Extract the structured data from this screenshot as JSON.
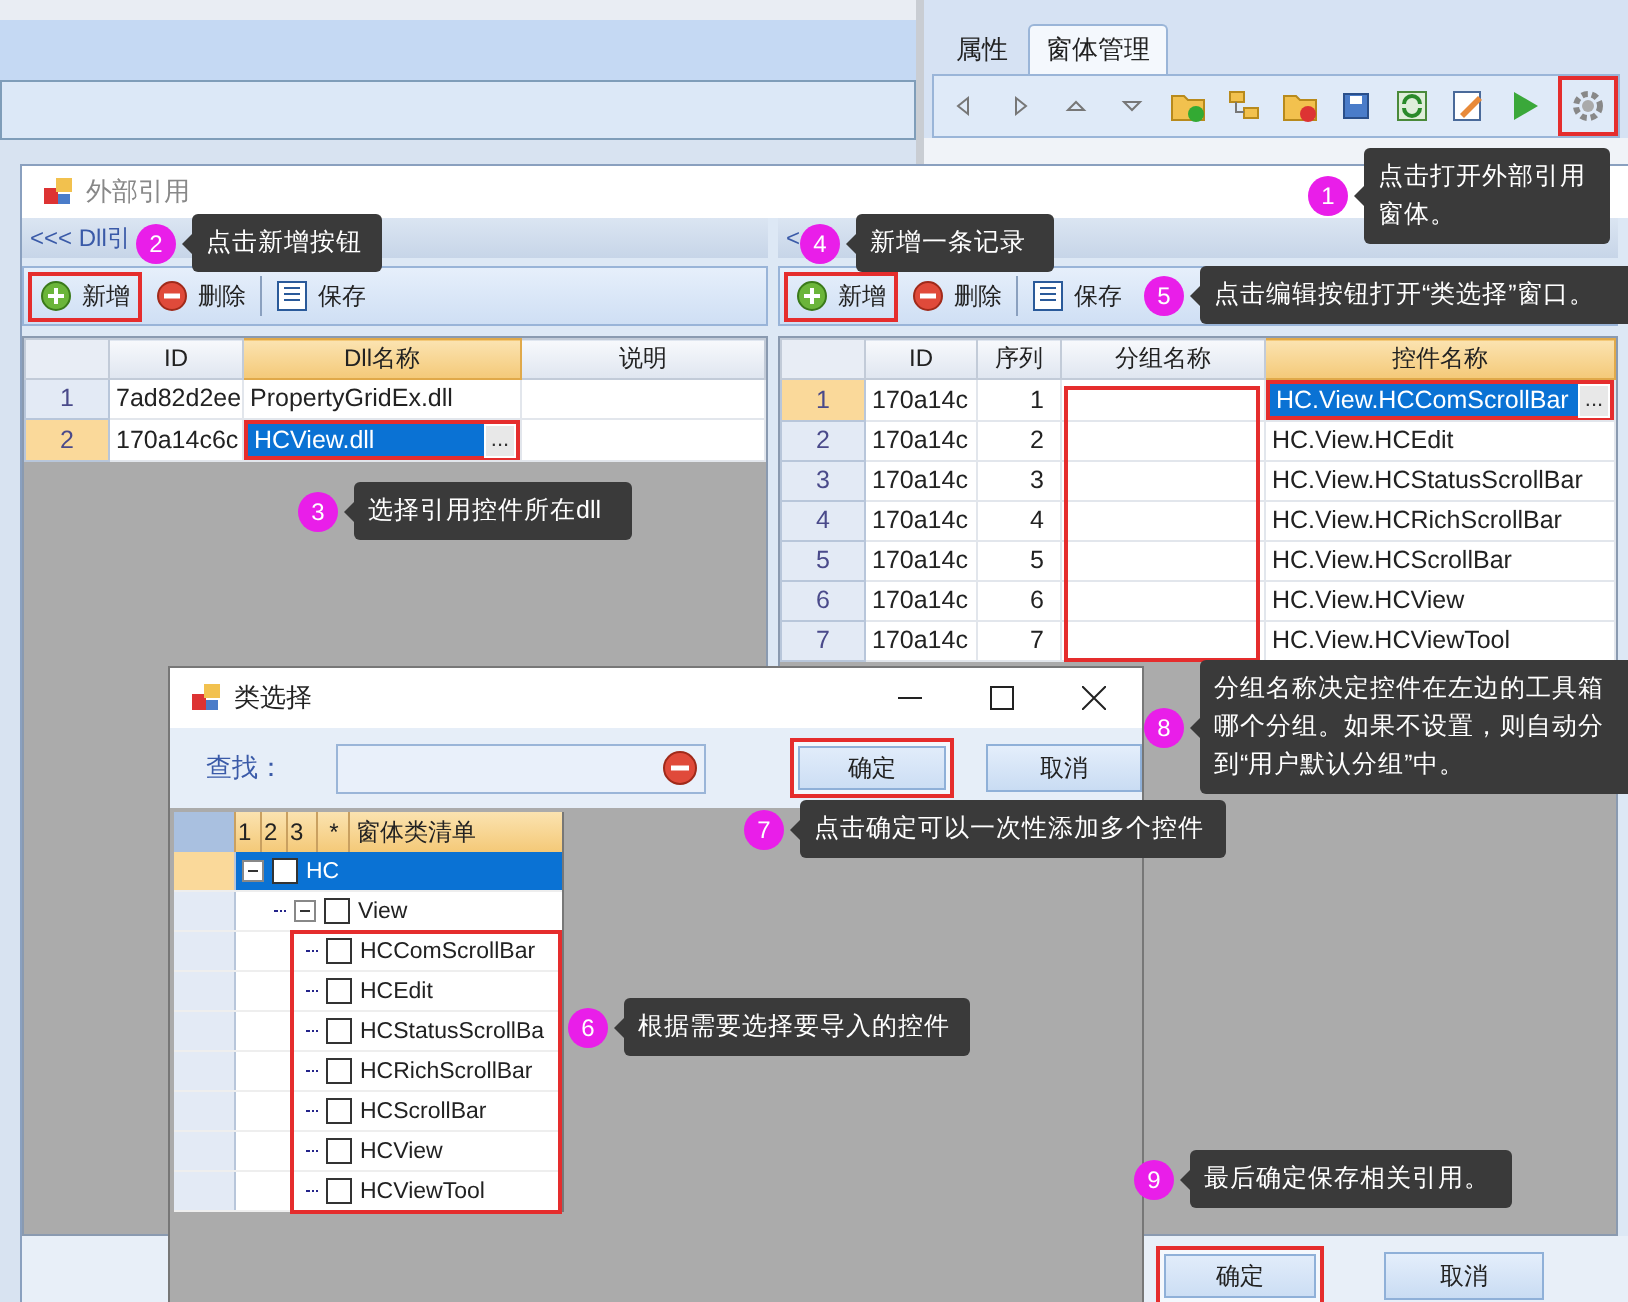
{
  "ide": {
    "tabs": [
      {
        "label": "属性",
        "selected": false
      },
      {
        "label": "窗体管理",
        "selected": true
      }
    ],
    "toolbar": [
      {
        "kind": "left",
        "highlighted": false
      },
      {
        "kind": "right",
        "highlighted": false
      },
      {
        "kind": "up",
        "highlighted": false
      },
      {
        "kind": "down",
        "highlighted": false
      },
      {
        "kind": "folder-add",
        "highlighted": false
      },
      {
        "kind": "tree",
        "highlighted": false
      },
      {
        "kind": "folder-remove",
        "highlighted": false
      },
      {
        "kind": "save",
        "highlighted": false
      },
      {
        "kind": "refresh",
        "highlighted": false
      },
      {
        "kind": "edit",
        "highlighted": false
      },
      {
        "kind": "run",
        "highlighted": false
      },
      {
        "kind": "settings",
        "highlighted": true
      }
    ]
  },
  "reference_dialog": {
    "title": "外部引用",
    "dll_pane": {
      "header": "<<< Dll引",
      "toolbar": [
        {
          "kind": "add",
          "label": "新增",
          "highlighted": true
        },
        {
          "kind": "delete",
          "label": "删除",
          "highlighted": false
        },
        {
          "kind": "save",
          "label": "保存",
          "highlighted": false
        }
      ],
      "columns": [
        {
          "label": "ID",
          "selected": false
        },
        {
          "label": "Dll名称",
          "selected": true
        },
        {
          "label": "说明",
          "selected": false
        }
      ],
      "rows": [
        {
          "number": "1",
          "selected": false,
          "id": "7ad82d2ee",
          "name": "PropertyGridEx.dll"
        },
        {
          "number": "2",
          "selected": true,
          "id": "170a14c6c",
          "name": "HCView.dll",
          "editor_button": "...",
          "highlighted": true
        }
      ]
    },
    "control_pane": {
      "header": "<",
      "toolbar": [
        {
          "kind": "add",
          "label": "新增",
          "highlighted": true
        },
        {
          "kind": "delete",
          "label": "删除",
          "highlighted": false
        },
        {
          "kind": "save",
          "label": "保存",
          "highlighted": false
        }
      ],
      "columns": [
        {
          "label": "ID",
          "selected": false
        },
        {
          "label": "序列",
          "selected": false
        },
        {
          "label": "分组名称",
          "selected": false
        },
        {
          "label": "控件名称",
          "selected": true
        }
      ],
      "group_column_highlighted": true,
      "rows": [
        {
          "number": "1",
          "selected": true,
          "id": "170a14c",
          "order": "1",
          "name": "HC.View.HCComScrollBar",
          "editor_button": "...",
          "highlighted": true
        },
        {
          "number": "2",
          "selected": false,
          "id": "170a14c",
          "order": "2",
          "name": "HC.View.HCEdit"
        },
        {
          "number": "3",
          "selected": false,
          "id": "170a14c",
          "order": "3",
          "name": "HC.View.HCStatusScrollBar"
        },
        {
          "number": "4",
          "selected": false,
          "id": "170a14c",
          "order": "4",
          "name": "HC.View.HCRichScrollBar"
        },
        {
          "number": "5",
          "selected": false,
          "id": "170a14c",
          "order": "5",
          "name": "HC.View.HCScrollBar"
        },
        {
          "number": "6",
          "selected": false,
          "id": "170a14c",
          "order": "6",
          "name": "HC.View.HCView"
        },
        {
          "number": "7",
          "selected": false,
          "id": "170a14c",
          "order": "7",
          "name": "HC.View.HCViewTool"
        }
      ]
    },
    "buttons": [
      {
        "label": "确定",
        "highlighted": true
      },
      {
        "label": "取消",
        "highlighted": false
      }
    ]
  },
  "class_dialog": {
    "title": "类选择",
    "search_label": "查找：",
    "buttons": [
      {
        "label": "确定",
        "highlighted": true
      },
      {
        "label": "取消",
        "highlighted": false
      }
    ],
    "tree_columns": [
      "1",
      "2",
      "3",
      "*",
      "窗体类清单"
    ],
    "items_highlighted": true,
    "tree": [
      {
        "label": "HC",
        "checked": false,
        "expanded": true,
        "selected": true,
        "children": [
          {
            "label": "View",
            "checked": false,
            "expanded": true,
            "selected": false,
            "children": [
              {
                "label": "HCComScrollBar",
                "checked": false,
                "selected": false
              },
              {
                "label": "HCEdit",
                "checked": false,
                "selected": false
              },
              {
                "label": "HCStatusScrollBa",
                "checked": false,
                "selected": false
              },
              {
                "label": "HCRichScrollBar",
                "checked": false,
                "selected": false
              },
              {
                "label": "HCScrollBar",
                "checked": false,
                "selected": false
              },
              {
                "label": "HCView",
                "checked": false,
                "selected": false
              },
              {
                "label": "HCViewTool",
                "checked": false,
                "selected": false
              }
            ]
          }
        ]
      }
    ]
  },
  "callouts": [
    {
      "number": "1",
      "text": "点击打开外部引用窗体。"
    },
    {
      "number": "2",
      "text": "点击新增按钮"
    },
    {
      "number": "3",
      "text": "选择引用控件所在dll"
    },
    {
      "number": "4",
      "text": "新增一条记录"
    },
    {
      "number": "5",
      "text": "点击编辑按钮打开“类选择”窗口。"
    },
    {
      "number": "6",
      "text": "根据需要选择要导入的控件"
    },
    {
      "number": "7",
      "text": "点击确定可以一次性添加多个控件"
    },
    {
      "number": "8",
      "text": "分组名称决定控件在左边的工具箱哪个分组。如果不设置，则自动分到“用户默认分组”中。"
    },
    {
      "number": "9",
      "text": "最后确定保存相关引用。"
    }
  ]
}
